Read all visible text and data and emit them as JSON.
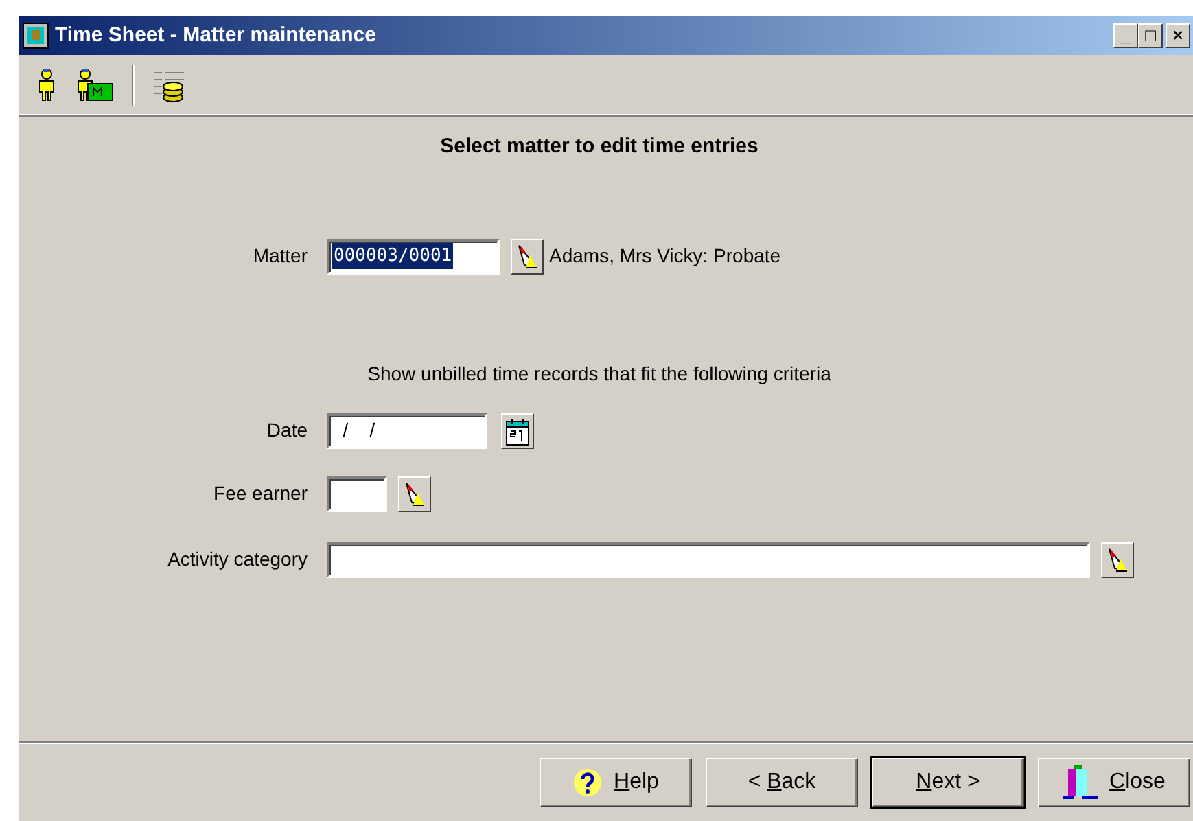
{
  "window": {
    "title": "Time Sheet - Matter maintenance",
    "controls": [
      "_",
      "□",
      "×"
    ]
  },
  "toolbar": [
    {
      "kind": "person"
    },
    {
      "kind": "person-matter"
    },
    {
      "kind": "separator"
    },
    {
      "kind": "coins"
    }
  ],
  "heading": "Select matter to edit time entries",
  "matter": {
    "label": "Matter",
    "value": "000003/0001",
    "selected": true,
    "description": "Adams, Mrs Vicky: Probate"
  },
  "criteria_caption": "Show unbilled time records that fit the following criteria",
  "fields": [
    {
      "label": "Date",
      "kind": "date",
      "value": "  /    /"
    },
    {
      "label": "Fee earner",
      "kind": "lookup-short"
    },
    {
      "label": "Activity category",
      "kind": "lookup-long"
    }
  ],
  "buttons": [
    {
      "kind": "help",
      "accel": "H",
      "rest": "elp",
      "default": false
    },
    {
      "kind": "back",
      "prefix": "< ",
      "accel": "B",
      "rest": "ack",
      "default": false
    },
    {
      "kind": "next",
      "accel": "N",
      "rest": "ext >",
      "default": true
    },
    {
      "kind": "close",
      "accel": "C",
      "rest": "lose",
      "default": false
    }
  ]
}
